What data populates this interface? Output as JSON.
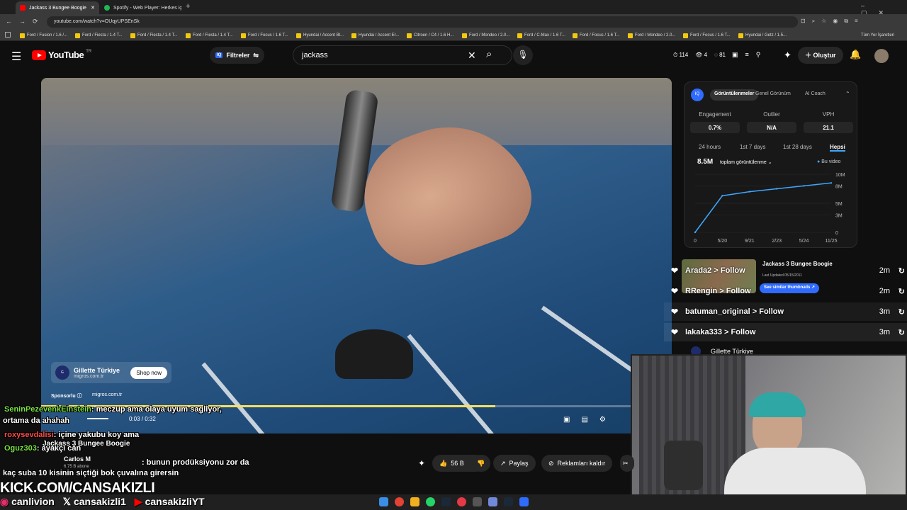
{
  "browser": {
    "tabs": [
      {
        "title": "Jackass 3 Bungee Boogie",
        "active": true
      },
      {
        "title": "Spotify - Web Player: Herkes iç",
        "active": false
      }
    ],
    "url": "youtube.com/watch?v=OUqyUPSEnSk",
    "bookmarks": [
      "Ford / Fusion / 1.6 /...",
      "Ford / Fiesta / 1.4 T...",
      "Ford / Fiesta / 1.4 T...",
      "Ford / Fiesta / 1.4 T...",
      "Ford / Focus / 1.6 T...",
      "Hyundai / Accent Bl...",
      "Hyundai / Accent Er...",
      "Citroen / C4 / 1.6 H...",
      "Ford / Mondeo / 2.0...",
      "Ford / C-Max / 1.6 T...",
      "Ford / Focus / 1.6 T...",
      "Ford / Mondeo / 2.0...",
      "Ford / Focus / 1.6 T...",
      "Hyundai / Getz / 1.5..."
    ],
    "all_bookmarks": "Tüm Yer İşaretleri"
  },
  "youtube": {
    "logo": "YouTube",
    "region": "TR",
    "filters": "Filtreler",
    "search_value": "jackass",
    "header_stats": [
      "114",
      "4",
      "81"
    ],
    "create": "Oluştur"
  },
  "ad": {
    "brand": "Gillette Türkiye",
    "domain": "migros.com.tr",
    "shop": "Shop now",
    "sponsored": "Sponsorlu",
    "site": "migros.com.tr",
    "time": "0:03 / 0:32",
    "progress": 0.72
  },
  "panel": {
    "tabs": [
      "Görüntülenmeler",
      "Genel Görünüm",
      "AI Coach"
    ],
    "stats": [
      {
        "label": "Engagement",
        "value": "0.7%"
      },
      {
        "label": "Outlier",
        "value": "N/A"
      },
      {
        "label": "VPH",
        "value": "21.1"
      }
    ],
    "ranges": [
      "24 hours",
      "1st 7 days",
      "1st 28 days",
      "Hepsi"
    ],
    "total": "8.5M",
    "total_label": "toplam görüntülenme",
    "legend": "Bu video"
  },
  "chart_data": {
    "type": "line",
    "x": [
      "0",
      "5/20",
      "9/21",
      "2/23",
      "5/24",
      "11/25"
    ],
    "y": [
      0,
      6.3,
      7.0,
      7.5,
      8.0,
      8.5
    ],
    "ylabel": "",
    "yticks": [
      "0",
      "3M",
      "5M",
      "8M",
      "10M"
    ],
    "ylim": [
      0,
      10
    ]
  },
  "recommend": {
    "title": "Jackass 3 Bungee Boogie",
    "updated": "Last Updated 05/15/2011",
    "similar": "See similar thumbnails"
  },
  "follows": [
    {
      "user": "Arada2",
      "action": "Follow",
      "time": "2m"
    },
    {
      "user": "RRengin",
      "action": "Follow",
      "time": "2m"
    },
    {
      "user": "batuman_original",
      "action": "Follow",
      "time": "3m"
    },
    {
      "user": "lakaka333",
      "action": "Follow",
      "time": "3m"
    }
  ],
  "channel_peek": "Gillette Türkiye",
  "chat": [
    {
      "user": "SeninPezevenkEinstein",
      "text": ": meczup ama olaya uyum sagliyor,"
    },
    {
      "user": "",
      "text": "ortama da ahahah"
    },
    {
      "user": "roxysevdalisi",
      "text": ": içine yakubu koy ama"
    },
    {
      "user": "Oguz303",
      "text": ": ayakçı can"
    },
    {
      "user": "",
      "text": "Jackass 3 Bungee Boogie"
    },
    {
      "user": "",
      "text": ": bunun prodüksiyonu zor da"
    },
    {
      "user": "",
      "text": "kaç suba 10 kisinin siçtiği bok çuvalına girersin"
    }
  ],
  "channel": {
    "name": "Carlos M",
    "subs": "6.75 B abone"
  },
  "actions": {
    "likes": "56 B",
    "share": "Paylaş",
    "remove_ads": "Reklamları kaldır"
  },
  "stream": {
    "kick": "KICK.COM/CANSAKIZLI",
    "handles": [
      "canlivion",
      "cansakizli1",
      "cansakizliYT"
    ]
  },
  "colors": {
    "accent": "#3ea6ff",
    "youtube_red": "#ff0000",
    "chat_green": "#7be342",
    "chat_red": "#ff4b4b",
    "chat_yellow": "#f6e05e"
  }
}
